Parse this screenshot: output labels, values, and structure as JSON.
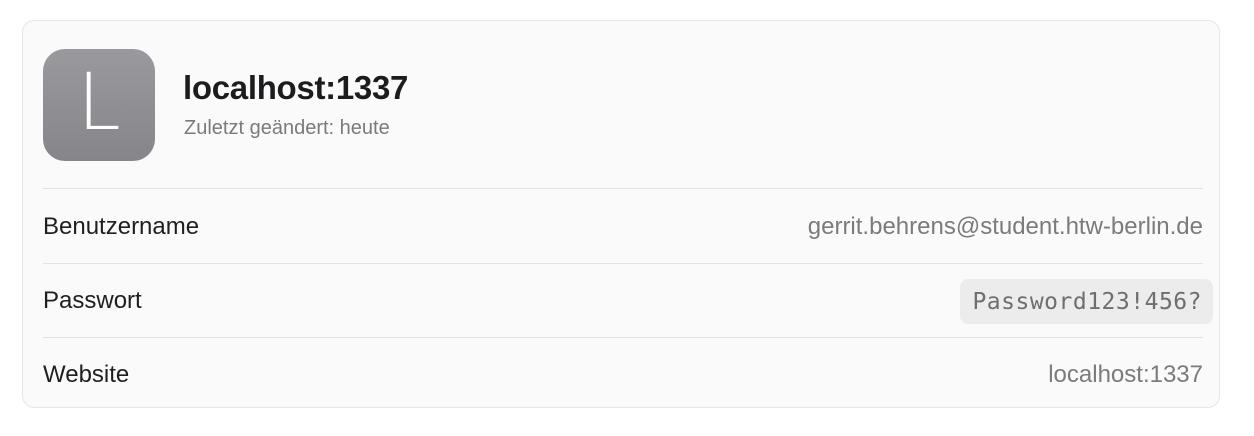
{
  "entry": {
    "avatar_letter": "L",
    "title": "localhost:1337",
    "subtitle": "Zuletzt geändert: heute"
  },
  "fields": {
    "username": {
      "label": "Benutzername",
      "value": "gerrit.behrens@student.htw-berlin.de"
    },
    "password": {
      "label": "Passwort",
      "value": "Password123!456?"
    },
    "website": {
      "label": "Website",
      "value": "localhost:1337"
    }
  },
  "colors": {
    "avatar_background": "#8f8e93",
    "card_background": "#fafafa",
    "password_chip": "#ececec"
  }
}
